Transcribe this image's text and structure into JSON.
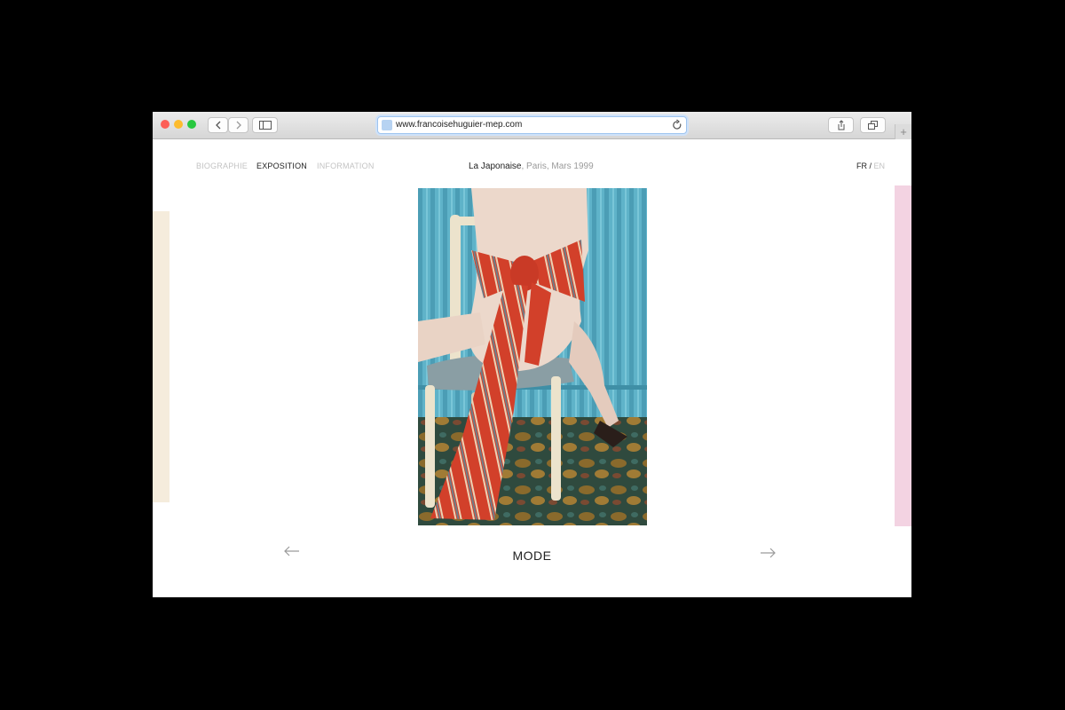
{
  "browser": {
    "url": "www.francoisehuguier-mep.com",
    "traffic_light_colors": {
      "close": "#fc5f57",
      "minimize": "#fdbc2e",
      "zoom": "#28c840"
    }
  },
  "nav": {
    "items": [
      {
        "label": "BIOGRAPHIE",
        "active": false
      },
      {
        "label": "EXPOSITION",
        "active": true
      },
      {
        "label": "INFORMATION",
        "active": false
      }
    ]
  },
  "caption": {
    "title": "La Japonaise",
    "details": ", Paris, Mars 1999"
  },
  "language": {
    "current": "FR",
    "separator": " / ",
    "other": "EN"
  },
  "gallery": {
    "section_title": "MODE",
    "prev_icon": "arrow-left-icon",
    "next_icon": "arrow-right-icon"
  },
  "colors": {
    "left_stripe": "#f5ecdc",
    "right_stripe": "#f3d3e2",
    "active_text": "#222222",
    "inactive_text": "#c3c3c3"
  }
}
